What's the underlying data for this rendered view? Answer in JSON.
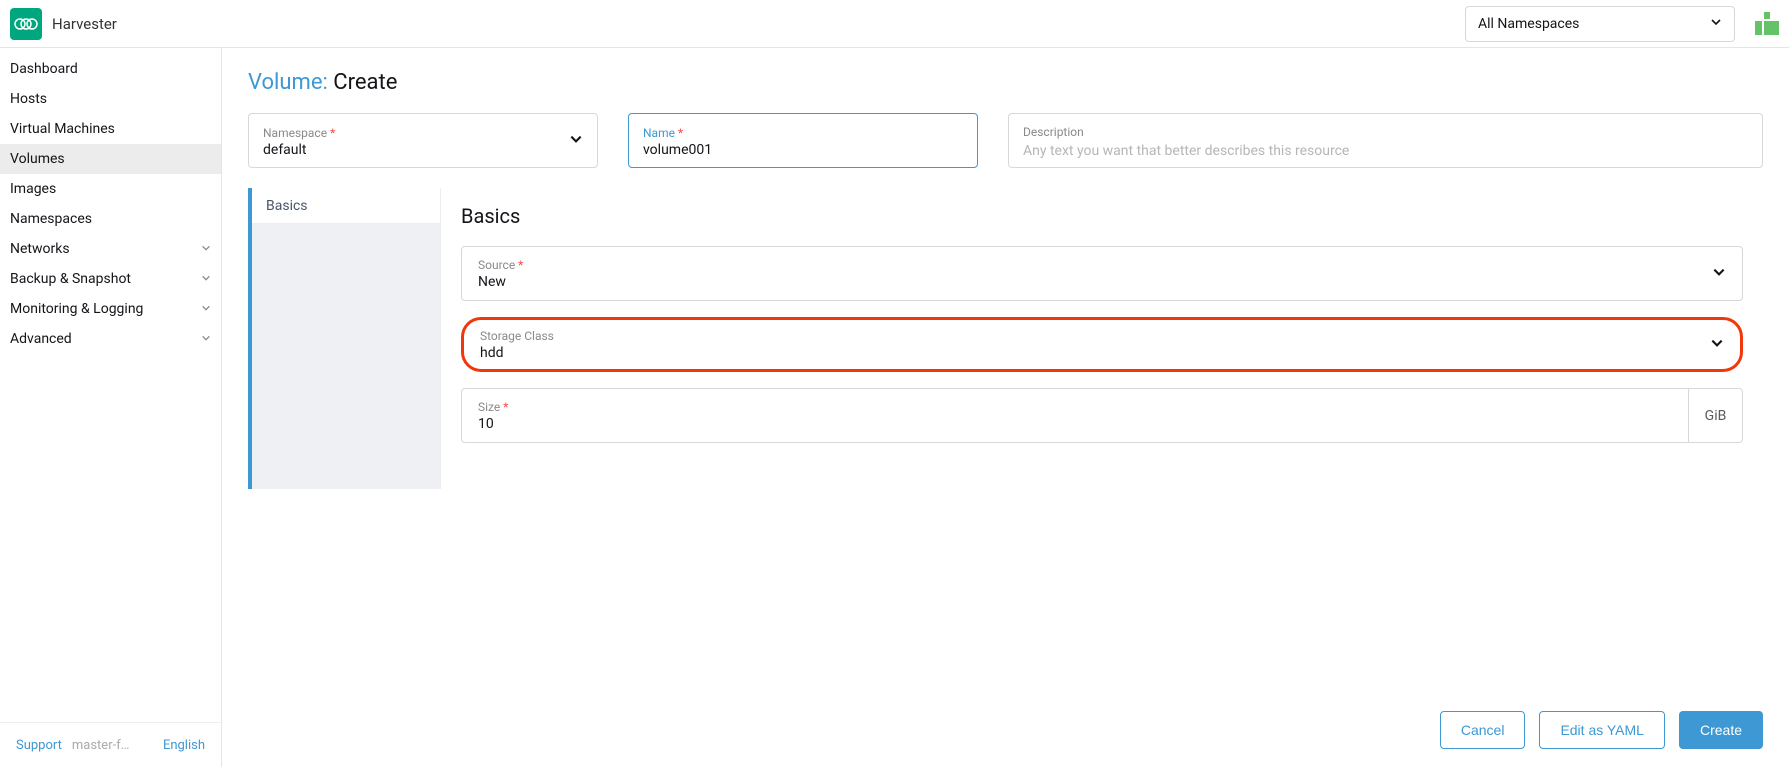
{
  "header": {
    "app_name": "Harvester",
    "namespace_selector": "All Namespaces"
  },
  "sidebar": {
    "items": [
      {
        "label": "Dashboard",
        "expandable": false,
        "active": false
      },
      {
        "label": "Hosts",
        "expandable": false,
        "active": false
      },
      {
        "label": "Virtual Machines",
        "expandable": false,
        "active": false
      },
      {
        "label": "Volumes",
        "expandable": false,
        "active": true
      },
      {
        "label": "Images",
        "expandable": false,
        "active": false
      },
      {
        "label": "Namespaces",
        "expandable": false,
        "active": false
      },
      {
        "label": "Networks",
        "expandable": true,
        "active": false
      },
      {
        "label": "Backup & Snapshot",
        "expandable": true,
        "active": false
      },
      {
        "label": "Monitoring & Logging",
        "expandable": true,
        "active": false
      },
      {
        "label": "Advanced",
        "expandable": true,
        "active": false
      }
    ],
    "footer": {
      "support": "Support",
      "version": "master-f…",
      "language": "English"
    }
  },
  "page": {
    "resource": "Volume:",
    "action": "Create",
    "fields": {
      "namespace": {
        "label": "Namespace",
        "required": true,
        "value": "default"
      },
      "name": {
        "label": "Name",
        "required": true,
        "value": "volume001"
      },
      "description": {
        "label": "Description",
        "placeholder": "Any text you want that better describes this resource"
      }
    },
    "tabs": {
      "basics": "Basics"
    },
    "basics": {
      "title": "Basics",
      "source": {
        "label": "Source",
        "required": true,
        "value": "New"
      },
      "storage_class": {
        "label": "Storage Class",
        "value": "hdd"
      },
      "size": {
        "label": "Size",
        "required": true,
        "value": "10",
        "unit": "GiB"
      }
    },
    "actions": {
      "cancel": "Cancel",
      "edit_yaml": "Edit as YAML",
      "create": "Create"
    }
  }
}
